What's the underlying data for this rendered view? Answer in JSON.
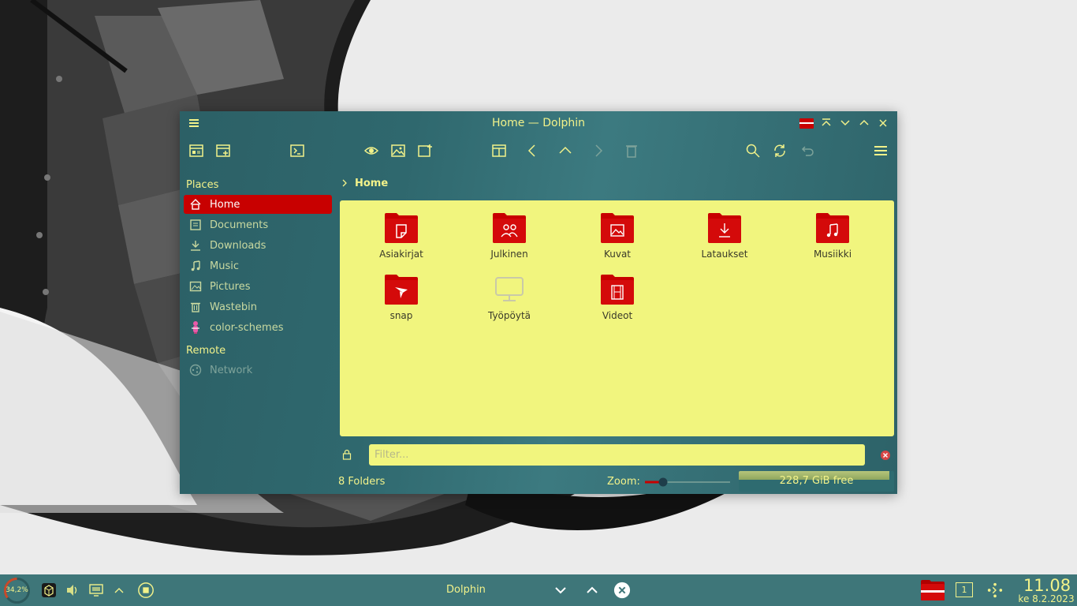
{
  "window": {
    "title": "Home — Dolphin"
  },
  "sidebar": {
    "places_title": "Places",
    "places": [
      {
        "label": "Home",
        "icon": "home-icon"
      },
      {
        "label": "Documents",
        "icon": "documents-icon"
      },
      {
        "label": "Downloads",
        "icon": "downloads-icon"
      },
      {
        "label": "Music",
        "icon": "music-icon"
      },
      {
        "label": "Pictures",
        "icon": "pictures-icon"
      },
      {
        "label": "Wastebin",
        "icon": "trash-icon"
      },
      {
        "label": "color-schemes",
        "icon": "color-schemes-icon"
      }
    ],
    "remote_title": "Remote",
    "remote": [
      {
        "label": "Network",
        "icon": "network-icon"
      }
    ]
  },
  "breadcrumb": {
    "current": "Home"
  },
  "files": [
    {
      "label": "Asiakirjat",
      "icon": "folder-documents-icon"
    },
    {
      "label": "Julkinen",
      "icon": "folder-public-icon"
    },
    {
      "label": "Kuvat",
      "icon": "folder-pictures-icon"
    },
    {
      "label": "Lataukset",
      "icon": "folder-downloads-icon"
    },
    {
      "label": "Musiikki",
      "icon": "folder-music-icon"
    },
    {
      "label": "snap",
      "icon": "folder-snap-icon"
    },
    {
      "label": "Työpöytä",
      "icon": "desktop-icon"
    },
    {
      "label": "Videot",
      "icon": "folder-videos-icon"
    }
  ],
  "filter": {
    "placeholder": "Filter..."
  },
  "status": {
    "folders": "8 Folders",
    "zoom_label": "Zoom:",
    "free_space": "228,7 GiB free",
    "disk_used_fraction": 0.97
  },
  "taskbar": {
    "cpu_load": "34,2%",
    "task_label": "Dolphin",
    "desktop_number": "1",
    "time": "11.08",
    "date": "ke 8.2.2023"
  },
  "colors": {
    "accent": "#c80000",
    "text": "#f2f28a",
    "view_bg": "#f1f57e",
    "window_bg": "#2f686e",
    "taskbar_bg": "#3e7679"
  }
}
